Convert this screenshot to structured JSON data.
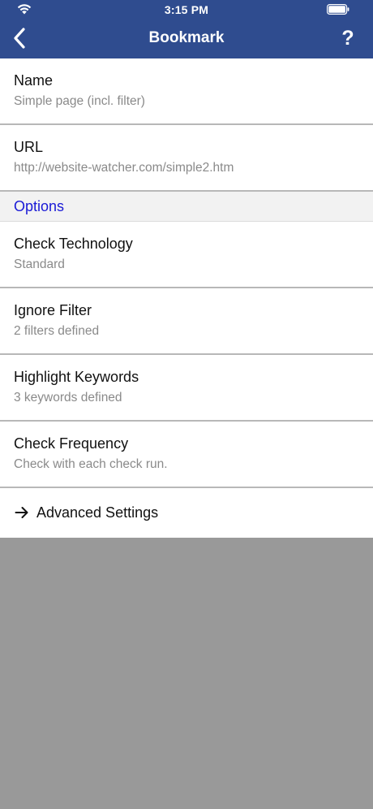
{
  "status_bar": {
    "time": "3:15 PM"
  },
  "nav": {
    "title": "Bookmark",
    "help_label": "?"
  },
  "fields": [
    {
      "label": "Name",
      "value": "Simple page (incl. filter)"
    },
    {
      "label": "URL",
      "value": "http://website-watcher.com/simple2.htm"
    }
  ],
  "options_section": {
    "header": "Options",
    "items": [
      {
        "label": "Check Technology",
        "value": "Standard"
      },
      {
        "label": "Ignore Filter",
        "value": "2 filters defined"
      },
      {
        "label": "Highlight Keywords",
        "value": "3 keywords defined"
      },
      {
        "label": "Check Frequency",
        "value": "Check with each check run."
      }
    ]
  },
  "advanced": {
    "label": "Advanced Settings",
    "icon": "arrow-right-icon"
  },
  "colors": {
    "nav_background": "#2f4c8f",
    "section_header_text": "#1a1ad6",
    "empty_background": "#999999"
  }
}
